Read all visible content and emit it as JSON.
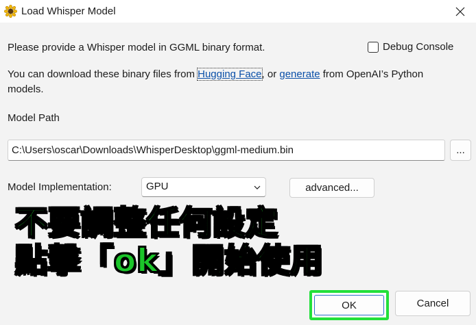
{
  "window": {
    "title": "Load Whisper Model",
    "app_icon": "sunflower-icon",
    "close_icon": "close-icon"
  },
  "intro": {
    "line1": "Please provide a Whisper model in GGML binary format.",
    "download_prefix": "You can download these binary files from ",
    "link_huggingface": "Hugging Face",
    "download_middle": ", or ",
    "link_generate": "generate",
    "download_suffix": " from OpenAI’s Python",
    "download_line2": "models."
  },
  "debug_console": {
    "label": "Debug Console",
    "checked": false
  },
  "model_path": {
    "label": "Model Path",
    "value": "C:\\Users\\oscar\\Downloads\\WhisperDesktop\\ggml-medium.bin",
    "browse_label": "..."
  },
  "implementation": {
    "label": "Model Implementation:",
    "selected": "GPU",
    "advanced_label": "advanced..."
  },
  "annotation": {
    "line1": "不要調整任何設定",
    "line2": "點擊「ok」開始使用",
    "color": "#1bc52a"
  },
  "buttons": {
    "ok_label": "OK",
    "cancel_label": "Cancel",
    "highlight_color": "#22e03a"
  }
}
